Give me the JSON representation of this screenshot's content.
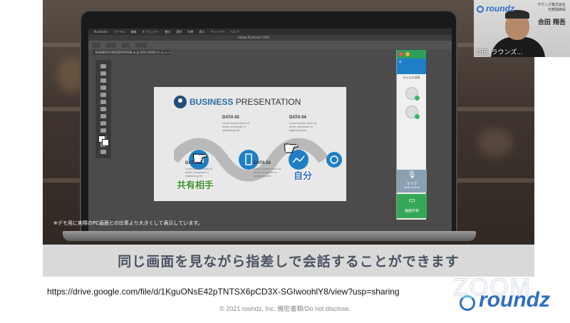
{
  "slide": {
    "caption": "同じ画面を見ながら指差しで会話することができます",
    "demo_note": "※デモ用に実際のPC画面との比率より大きくして表示しています。",
    "label_partner": "共有相手",
    "label_self": "自分"
  },
  "illustrator": {
    "app_title": "Adobe Illustrator 2021",
    "menu": [
      "Illustrator",
      "ファイル",
      "編集",
      "オブジェクト",
      "書式",
      "選択",
      "効果",
      "表示",
      "ウィンドウ",
      "ヘルプ"
    ],
    "tab_label": "BUSINESS PRESENTATION.ai @ 50% (RGB/プレビュー)",
    "artboard": {
      "title_bold": "BUSINESS",
      "title_rest": " PRESENTATION",
      "data": [
        {
          "label": "DATA 01",
          "text": "Lorem ipsum dolor sit amet, consectet ur adipiscing elit"
        },
        {
          "label": "DATA 02",
          "text": "Lorem ipsum dolor sit amet, consectet ur adipiscing elit"
        },
        {
          "label": "DATA 03",
          "text": "Lorem ipsum dolor sit amet, consectet ur adipiscing elit"
        },
        {
          "label": "DATA 04",
          "text": "Lorem ipsum dolor sit amet, consectet ur adipiscing elit"
        }
      ]
    }
  },
  "roundz_panel": {
    "room_label": "みんなの部屋",
    "mic_label": "マイク",
    "mic_sub": "Multi Control",
    "share_label": "画面共有"
  },
  "footer": {
    "url": "https://drive.google.com/file/d/1KguONsE42pTNTSX6pCD3X-SGIwoohlY8/view?usp=sharing",
    "copyright": "© 2021 roundz, Inc. 機密書類/Do not disclose."
  },
  "logo": {
    "zoom_text": "ZOOM",
    "brand": "roundz"
  },
  "video": {
    "brand": "roundz",
    "company_line1": "ラウンズ株式会社",
    "company_line2": "代表取締役",
    "person_name": "合田 翔吾",
    "caption": "合田_ラウンズ..."
  },
  "colors": {
    "accent_blue": "#2f6ec3",
    "green": "#35a857",
    "caption_text": "#4a5260"
  }
}
